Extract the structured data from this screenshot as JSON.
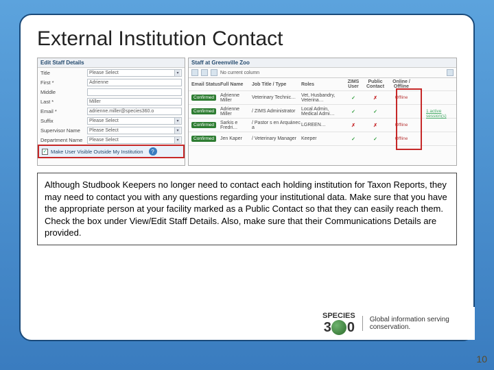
{
  "title": "External Institution Contact",
  "leftPanel": {
    "header": "Edit Staff Details",
    "rows": {
      "title": {
        "label": "Title",
        "value": "Please Select"
      },
      "first": {
        "label": "First *",
        "value": "Adrienne"
      },
      "middle": {
        "label": "Middle",
        "value": ""
      },
      "last": {
        "label": "Last *",
        "value": "Miller"
      },
      "email": {
        "label": "Email *",
        "value": "adrienne.miller@species360.o"
      },
      "suffix": {
        "label": "Suffix",
        "value": "Please Select"
      },
      "super": {
        "label": "Supervisor Name",
        "value": "Please Select"
      },
      "dept": {
        "label": "Department Name",
        "value": "Please Select"
      }
    },
    "checkbox": {
      "label": "Make User Visible Outside My Institution",
      "checked": true
    }
  },
  "rightPanel": {
    "header": "Staff at Greenville Zoo",
    "toolbarNote": "No current column",
    "columns": {
      "status": "Email Status",
      "name": "Full Name",
      "title": "Job Title / Type",
      "roles": "Roles",
      "zims": "ZIMS User",
      "pub": "Public Contact",
      "onoff": "Online / Offline"
    },
    "rows": [
      {
        "status": "Confirmed",
        "name": "Adrienne Miller",
        "title": "Veterinary Technic…",
        "roles": "Vet, Husbandry, Veterina…",
        "zims": "✓",
        "pub": "✗",
        "onoff": "Offline"
      },
      {
        "status": "Confirmed",
        "name": "Adrienne Miller",
        "title": "/ ZIMS Administrator",
        "roles": "Local Admin, Medical Admi…",
        "zims": "✓",
        "pub": "✓",
        "onoff": "1 active session(s)"
      },
      {
        "status": "Confirmed",
        "name": "Sarkis e Fredri…",
        "title": "/ Pastor s en Arquánec a",
        "roles": "LGREEN…",
        "zims": "✗",
        "pub": "✗",
        "onoff": "Offline"
      },
      {
        "status": "Confirmed",
        "name": "Jen Kaper",
        "title": "/ Veterinary Manager",
        "roles": "Keeper",
        "zims": "✓",
        "pub": "✓",
        "onoff": "Offline"
      }
    ]
  },
  "note": "Although Studbook Keepers no longer need to contact each holding institution for Taxon Reports, they may need to contact you with any questions regarding your institutional data. Make sure that you have the appropriate person at your facility marked as a Public Contact so that they can easily reach them. Check the box under View/Edit Staff Details. Also, make sure that their Communications Details are provided.",
  "logo": {
    "brand": "SPECIES",
    "left": "3",
    "right": "0",
    "tagline": "Global information serving conservation."
  },
  "pageNumber": "10"
}
